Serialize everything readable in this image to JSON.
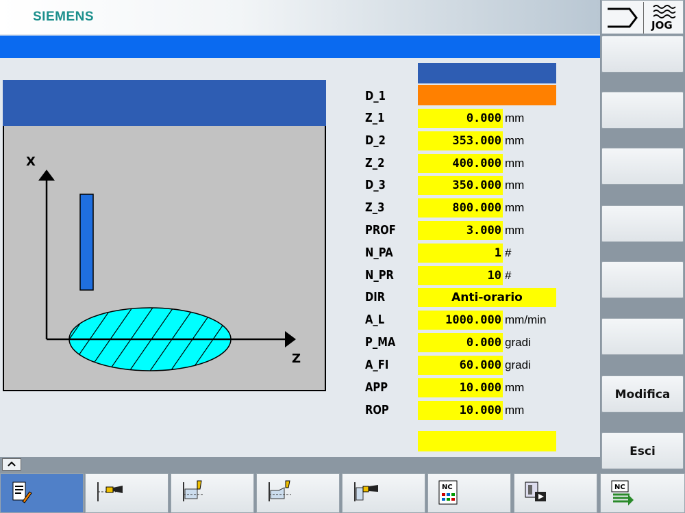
{
  "header": {
    "brand": "SIEMENS",
    "mode": "JOG"
  },
  "diagram": {
    "x_axis": "X",
    "z_axis": "Z"
  },
  "params": [
    {
      "label": "D_1",
      "value": "",
      "unit": ""
    },
    {
      "label": "Z_1",
      "value": "0.000",
      "unit": "mm"
    },
    {
      "label": "D_2",
      "value": "353.000",
      "unit": "mm"
    },
    {
      "label": "Z_2",
      "value": "400.000",
      "unit": "mm"
    },
    {
      "label": "D_3",
      "value": "350.000",
      "unit": "mm"
    },
    {
      "label": "Z_3",
      "value": "800.000",
      "unit": "mm"
    },
    {
      "label": "PROF",
      "value": "3.000",
      "unit": "mm"
    },
    {
      "label": "N_PA",
      "value": "1",
      "unit": "#"
    },
    {
      "label": "N_PR",
      "value": "10",
      "unit": "#"
    },
    {
      "label": "DIR",
      "value": "Anti-orario",
      "unit": ""
    },
    {
      "label": "A_L",
      "value": "1000.000",
      "unit": "mm/min"
    },
    {
      "label": "P_MA",
      "value": "0.000",
      "unit": "gradi"
    },
    {
      "label": "A_FI",
      "value": "60.000",
      "unit": "gradi"
    },
    {
      "label": "APP",
      "value": "10.000",
      "unit": "mm"
    },
    {
      "label": "ROP",
      "value": "10.000",
      "unit": "mm"
    }
  ],
  "softkeys": {
    "modify": "Modifica",
    "exit": "Esci"
  },
  "toolbar": {
    "nc_label": "NC"
  },
  "colors": {
    "accent_blue": "#0a6af0",
    "field_yellow": "#ffff00",
    "field_orange": "#ff8000",
    "panel_blue": "#2e5db3",
    "part_cyan": "#00ffff"
  }
}
